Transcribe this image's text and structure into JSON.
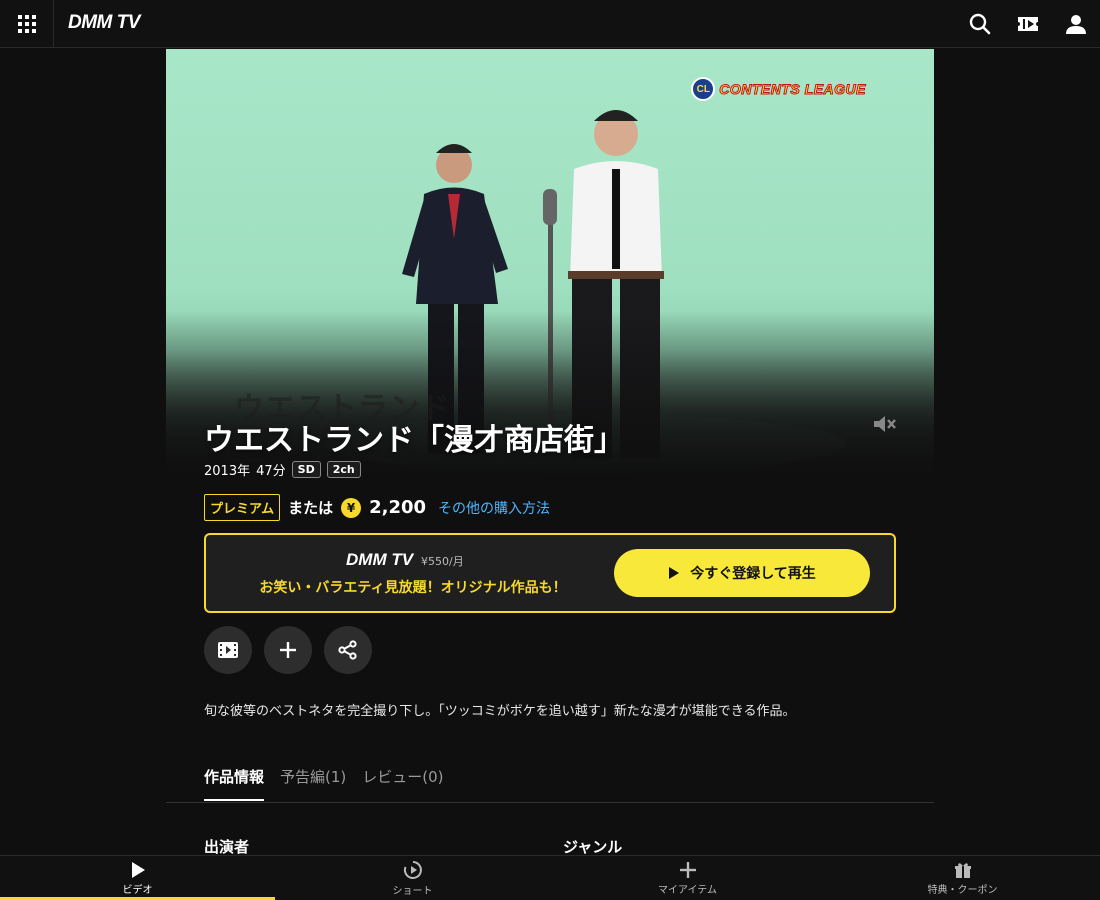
{
  "header": {
    "logo": "DMM TV",
    "icons": [
      "grid-menu-icon",
      "search-icon",
      "ticket-icon",
      "user-icon"
    ]
  },
  "hero": {
    "overlay_logo": "CONTENTS LEAGUE",
    "overlay_badge": "CL",
    "watermark": "ウエストランド",
    "mute_icon": "volume-mute-icon"
  },
  "title": "ウエストランド「漫才商店街」",
  "meta": {
    "year": "2013年",
    "duration": "47分",
    "quality": "SD",
    "audio": "2ch"
  },
  "pricing": {
    "premium": "プレミアム",
    "or": "または",
    "yen_symbol": "¥",
    "price": "2,200",
    "other_methods": "その他の購入方法"
  },
  "promo": {
    "brand": "DMM TV",
    "monthly_price": "¥550/月",
    "tagline": "お笑い・バラエティ見放題！オリジナル作品も！",
    "cta": "今すぐ登録して再生"
  },
  "actions": [
    "trailer-icon",
    "add-icon",
    "share-icon"
  ],
  "description": "旬な彼等のベストネタを完全撮り下し。「ツッコミがボケを追い越す」新たな漫才が堪能できる作品。",
  "tabs": [
    {
      "label": "作品情報",
      "active": true
    },
    {
      "label": "予告編(1)",
      "active": false
    },
    {
      "label": "レビュー(0)",
      "active": false
    }
  ],
  "sections": {
    "cast": "出演者",
    "genre": "ジャンル"
  },
  "bottom_nav": [
    {
      "label": "ビデオ",
      "icon": "play-icon",
      "active": true
    },
    {
      "label": "ショート",
      "icon": "short-icon",
      "active": false
    },
    {
      "label": "マイアイテム",
      "icon": "plus-icon",
      "active": false
    },
    {
      "label": "特典・クーポン",
      "icon": "gift-icon",
      "active": false
    }
  ],
  "colors": {
    "accent": "#f7d92b",
    "link": "#4fb6ff",
    "background": "#0f0f0f"
  }
}
